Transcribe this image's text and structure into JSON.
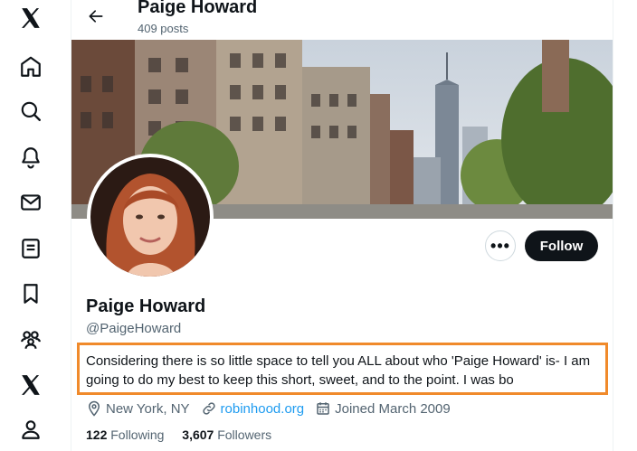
{
  "nav": {
    "items": [
      {
        "name": "x-logo-icon"
      },
      {
        "name": "home-icon"
      },
      {
        "name": "search-icon"
      },
      {
        "name": "notifications-icon"
      },
      {
        "name": "messages-icon"
      },
      {
        "name": "lists-icon"
      },
      {
        "name": "bookmarks-icon"
      },
      {
        "name": "communities-icon"
      },
      {
        "name": "premium-x-icon"
      },
      {
        "name": "profile-icon"
      }
    ]
  },
  "header": {
    "title": "Paige Howard",
    "posts": "409 posts"
  },
  "profile": {
    "name": "Paige Howard",
    "handle": "@PaigeHoward",
    "bio": "Considering there is so little space to tell you ALL about who 'Paige Howard' is- I am going to do my best to keep this short, sweet, and to the point. I was bo",
    "location": "New York, NY",
    "website": "robinhood.org",
    "joined": "Joined March 2009",
    "following_count": "122",
    "following_label": "Following",
    "followers_count": "3,607",
    "followers_label": "Followers"
  },
  "actions": {
    "more": "•••",
    "follow": "Follow"
  },
  "colors": {
    "accent": "#1d9bf0",
    "highlight_border": "#f08a2b",
    "text": "#0f1419",
    "muted": "#536471"
  }
}
